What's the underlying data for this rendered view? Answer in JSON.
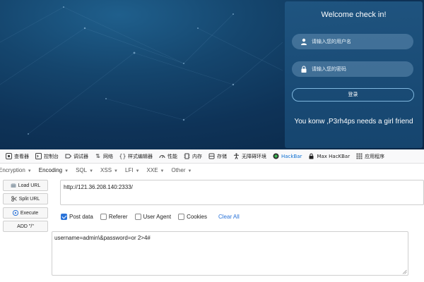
{
  "webpage": {
    "welcome": "Welcome check in!",
    "username_placeholder": "请输入您的用户名",
    "password_placeholder": "请输入您的密码",
    "login_button": "登录",
    "tagline": "You konw ,P3rh4ps needs a girl friend",
    "colors": {
      "background": "#0e3358",
      "card": "#1a4d7a",
      "button_border": "#7fb7de"
    }
  },
  "devtools": {
    "tabs": [
      {
        "label": "查看器",
        "icon": "inspector-icon"
      },
      {
        "label": "控制台",
        "icon": "console-icon"
      },
      {
        "label": "调试器",
        "icon": "debugger-icon"
      },
      {
        "label": "网络",
        "icon": "network-icon"
      },
      {
        "label": "样式编辑器",
        "icon": "style-editor-icon"
      },
      {
        "label": "性能",
        "icon": "performance-icon"
      },
      {
        "label": "内存",
        "icon": "memory-icon"
      },
      {
        "label": "存储",
        "icon": "storage-icon"
      },
      {
        "label": "无障碍环境",
        "icon": "accessibility-icon"
      },
      {
        "label": "HackBar",
        "icon": "hackbar-icon",
        "active": true
      },
      {
        "label": "Max HacKBar",
        "icon": "max-hackbar-icon"
      },
      {
        "label": "应用程序",
        "icon": "application-icon"
      }
    ]
  },
  "hackbar": {
    "menus": [
      "Encryption",
      "Encoding",
      "SQL",
      "XSS",
      "LFI",
      "XXE",
      "Other"
    ],
    "buttons": {
      "load": "Load URL",
      "split": "Split URL",
      "execute": "Execute",
      "add": "ADD \"/\""
    },
    "url": "http://121.36.208.140:2333/",
    "options": {
      "post_data": "Post data",
      "referer": "Referer",
      "user_agent": "User Agent",
      "cookies": "Cookies",
      "clear_all": "Clear All",
      "post_data_checked": true,
      "referer_checked": false,
      "user_agent_checked": false,
      "cookies_checked": false
    },
    "post_body": "username=admin\\&password=or 2>4#",
    "colors": {
      "accent": "#2a73d9"
    }
  }
}
